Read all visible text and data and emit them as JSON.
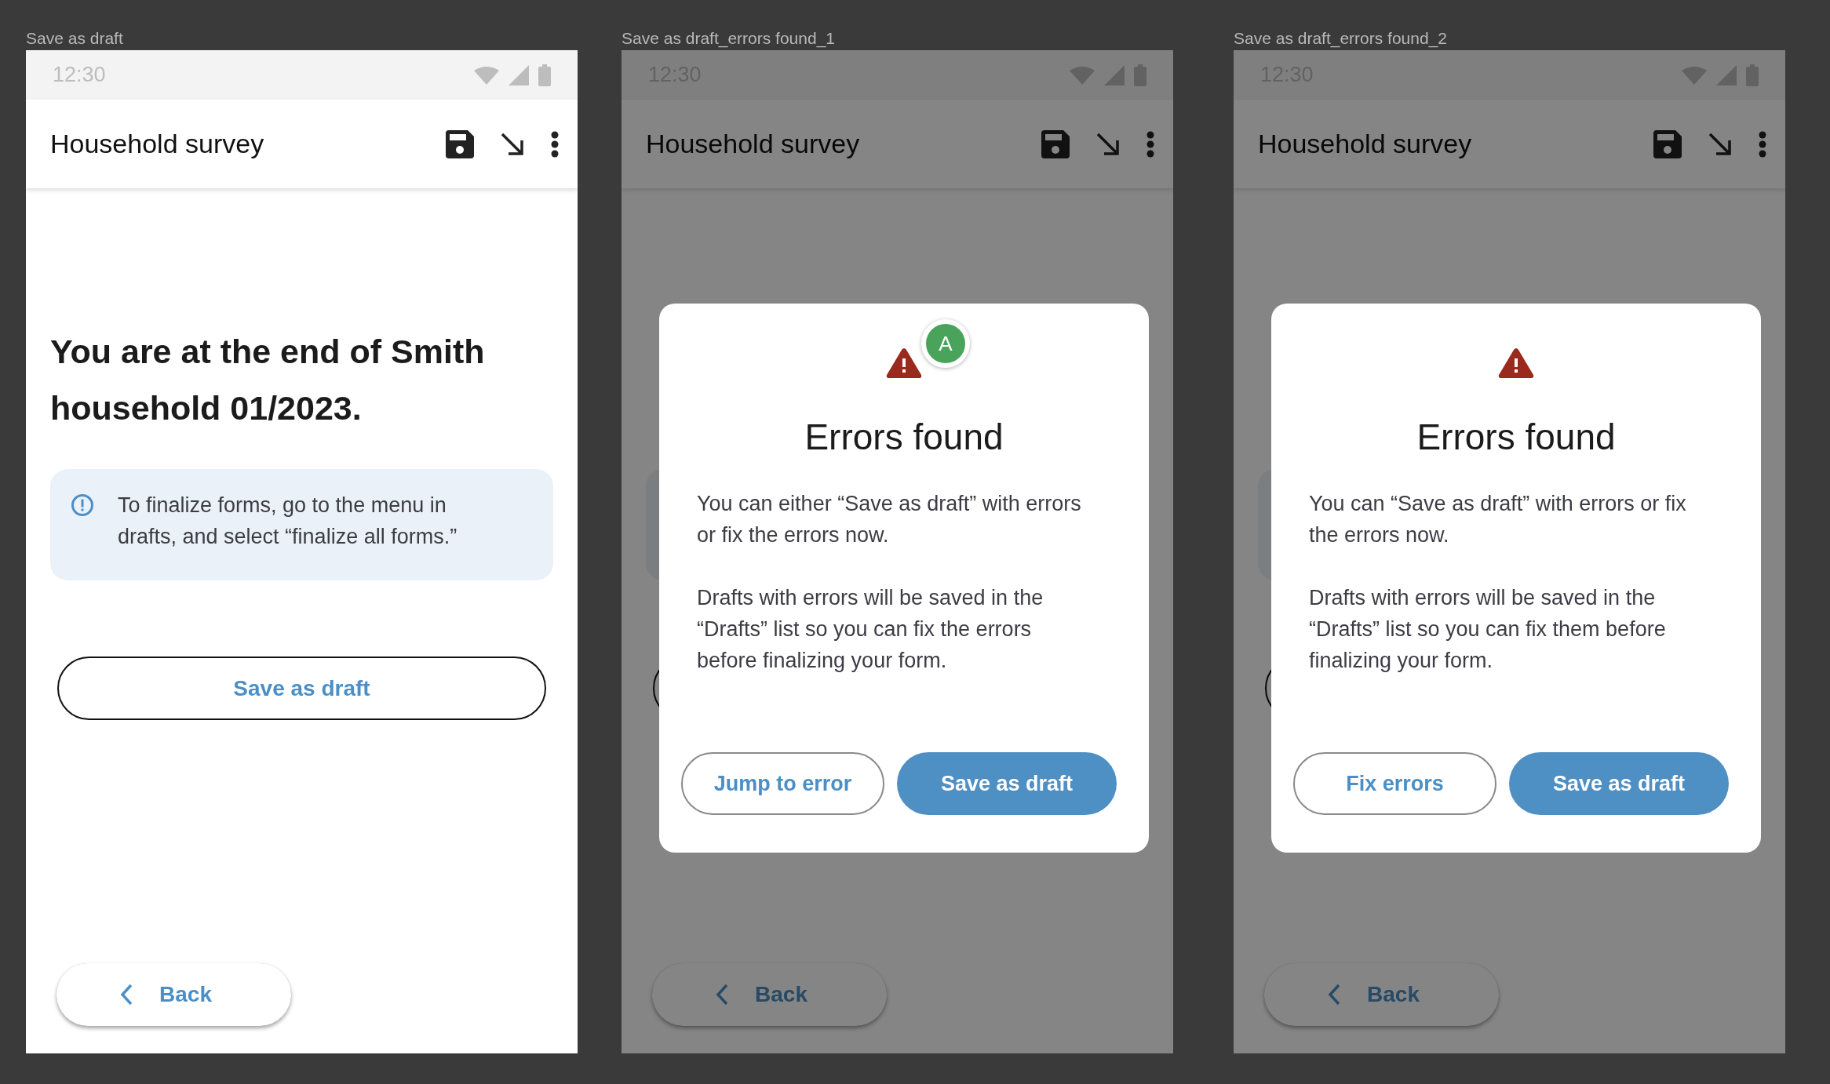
{
  "frames": [
    {
      "label": "Save as draft",
      "status_bar": {
        "time": "12:30"
      },
      "app_bar": {
        "title": "Household survey"
      },
      "page": {
        "heading_lines": [
          "You are at the end of Smith",
          "household 01/2023."
        ],
        "info_box": true,
        "info_lines": [
          "To finalize forms, go to the menu in",
          "drafts, and select “finalize all forms.”"
        ],
        "draft_button": {
          "label": "Save as draft"
        }
      },
      "back_button": "Back"
    },
    {
      "label": "Save as draft_errors found_1",
      "status_bar": {
        "time": "12:30"
      },
      "app_bar": {
        "title": "Household survey"
      },
      "page": {
        "info_box": true,
        "draft_outline": true
      },
      "back_button": "Back",
      "dialog": {
        "avatar": {
          "letter": "A",
          "color": "#4aa35a"
        },
        "title": "Errors found",
        "paragraphs": [
          [
            "You can either “Save as draft” with errors",
            "or fix the errors now."
          ],
          [
            "Drafts with errors will be saved in the",
            "“Drafts” list so you can fix the errors",
            "before finalizing your form."
          ]
        ],
        "buttons": [
          {
            "label": "Jump to error",
            "kind": "outlined"
          },
          {
            "label": "Save as draft",
            "kind": "filled"
          }
        ]
      }
    },
    {
      "label": "Save as draft_errors found_2",
      "status_bar": {
        "time": "12:30"
      },
      "app_bar": {
        "title": "Household survey"
      },
      "page": {
        "info_box": true,
        "draft_outline": true
      },
      "back_button": "Back",
      "dialog": {
        "title": "Errors found",
        "paragraphs": [
          [
            "You can “Save as draft” with errors or fix",
            "the errors now."
          ],
          [
            "Drafts with errors will be saved in the",
            "“Drafts” list so you can fix them before",
            "finalizing your form."
          ]
        ],
        "buttons": [
          {
            "label": "Fix errors",
            "kind": "outlined"
          },
          {
            "label": "Save as draft",
            "kind": "filled"
          }
        ]
      }
    }
  ]
}
